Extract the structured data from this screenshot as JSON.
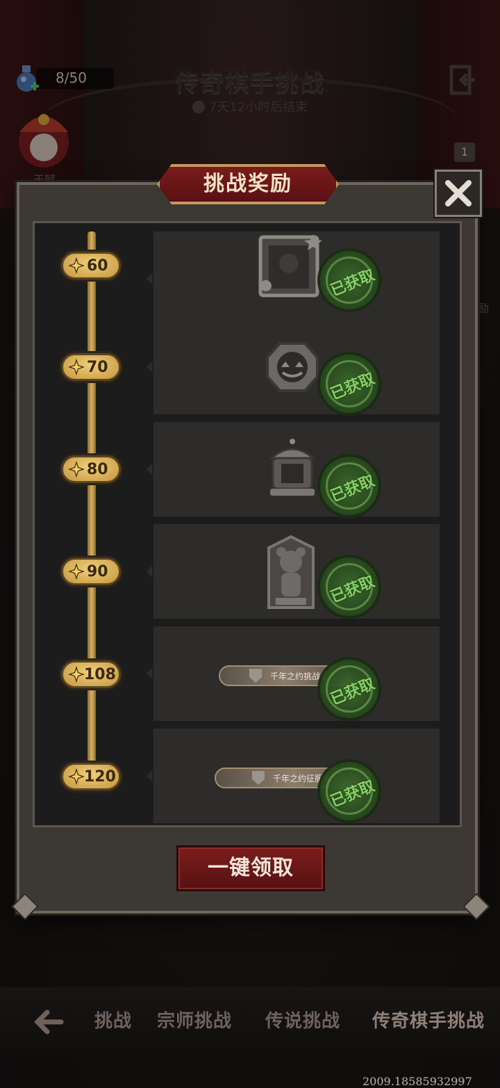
{
  "header": {
    "energy": "8/50",
    "title": "传奇棋手挑战",
    "timer": "7天12小时后结束",
    "avatar_label": "天赋",
    "side_label": "励",
    "badge": "1"
  },
  "modal": {
    "title": "挑战奖励",
    "claim_all": "一键领取",
    "status_claimed": "已获取",
    "rewards": [
      {
        "threshold": "60",
        "item": "frame-icon"
      },
      {
        "threshold": "70",
        "item": "pumpkin-badge-icon"
      },
      {
        "threshold": "80",
        "item": "carousel-badge-icon"
      },
      {
        "threshold": "90",
        "item": "bear-statue-icon"
      },
      {
        "threshold": "108",
        "item": "title-banner",
        "title_text": "千年之约挑战者"
      },
      {
        "threshold": "120",
        "item": "title-banner",
        "title_text": "千年之约征服者"
      }
    ]
  },
  "bottom_nav": {
    "tabs": [
      "挑战",
      "宗师挑战",
      "传说挑战",
      "传奇棋手挑战"
    ],
    "active": "传奇棋手挑战"
  },
  "watermark": "2009.18585932997",
  "colors": {
    "accent_gold": "#d9b262",
    "button_red": "#7c1d1c",
    "stamp_green": "#8bd96a"
  }
}
